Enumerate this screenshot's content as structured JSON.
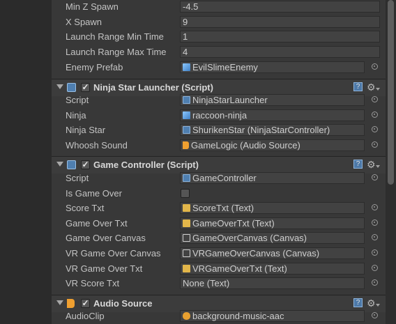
{
  "spawner_fields": [
    {
      "label": "Min Z Spawn",
      "value": "-4.5"
    },
    {
      "label": "X Spawn",
      "value": "9"
    },
    {
      "label": "Launch Range Min Time",
      "value": "1"
    },
    {
      "label": "Launch Range Max Time",
      "value": "4"
    }
  ],
  "enemy_prefab": {
    "label": "Enemy Prefab",
    "value": "EvilSlimeEnemy",
    "icon": "prefab-cube-icon"
  },
  "ninja_star_launcher": {
    "title": "Ninja Star Launcher (Script)",
    "enabled": true,
    "fields": [
      {
        "label": "Script",
        "value": "NinjaStarLauncher",
        "icon": "script-icon"
      },
      {
        "label": "Ninja",
        "value": "raccoon-ninja",
        "icon": "prefab-cube-icon"
      },
      {
        "label": "Ninja Star",
        "value": "ShurikenStar (NinjaStarController)",
        "icon": "script-icon"
      },
      {
        "label": "Whoosh Sound",
        "value": "GameLogic (Audio Source)",
        "icon": "audio-source-icon"
      }
    ]
  },
  "game_controller": {
    "title": "Game Controller (Script)",
    "enabled": true,
    "script": {
      "label": "Script",
      "value": "GameController",
      "icon": "script-icon"
    },
    "is_game_over": {
      "label": "Is Game Over",
      "checked": false
    },
    "fields": [
      {
        "label": "Score Txt",
        "value": "ScoreTxt (Text)",
        "icon": "text-icon"
      },
      {
        "label": "Game Over Txt",
        "value": "GameOverTxt (Text)",
        "icon": "text-icon"
      },
      {
        "label": "Game Over Canvas",
        "value": "GameOverCanvas (Canvas)",
        "icon": "canvas-icon"
      },
      {
        "label": "VR Game Over Canvas",
        "value": "VRGameOverCanvas (Canvas)",
        "icon": "canvas-icon"
      },
      {
        "label": "VR Game Over Txt",
        "value": "VRGameOverTxt (Text)",
        "icon": "text-icon"
      },
      {
        "label": "VR Score Txt",
        "value": "None (Text)",
        "icon": ""
      }
    ]
  },
  "audio_source": {
    "title": "Audio Source",
    "enabled": true,
    "fields": [
      {
        "label": "AudioClip",
        "value": "background-music-aac",
        "icon": "audio-clip-icon"
      }
    ]
  },
  "header_buttons": {
    "help": "?",
    "gear": "⚙"
  },
  "colors": {
    "background": "#383838",
    "field": "#424242",
    "script_blue": "#4f7fb0",
    "audio_orange": "#f0a030"
  }
}
